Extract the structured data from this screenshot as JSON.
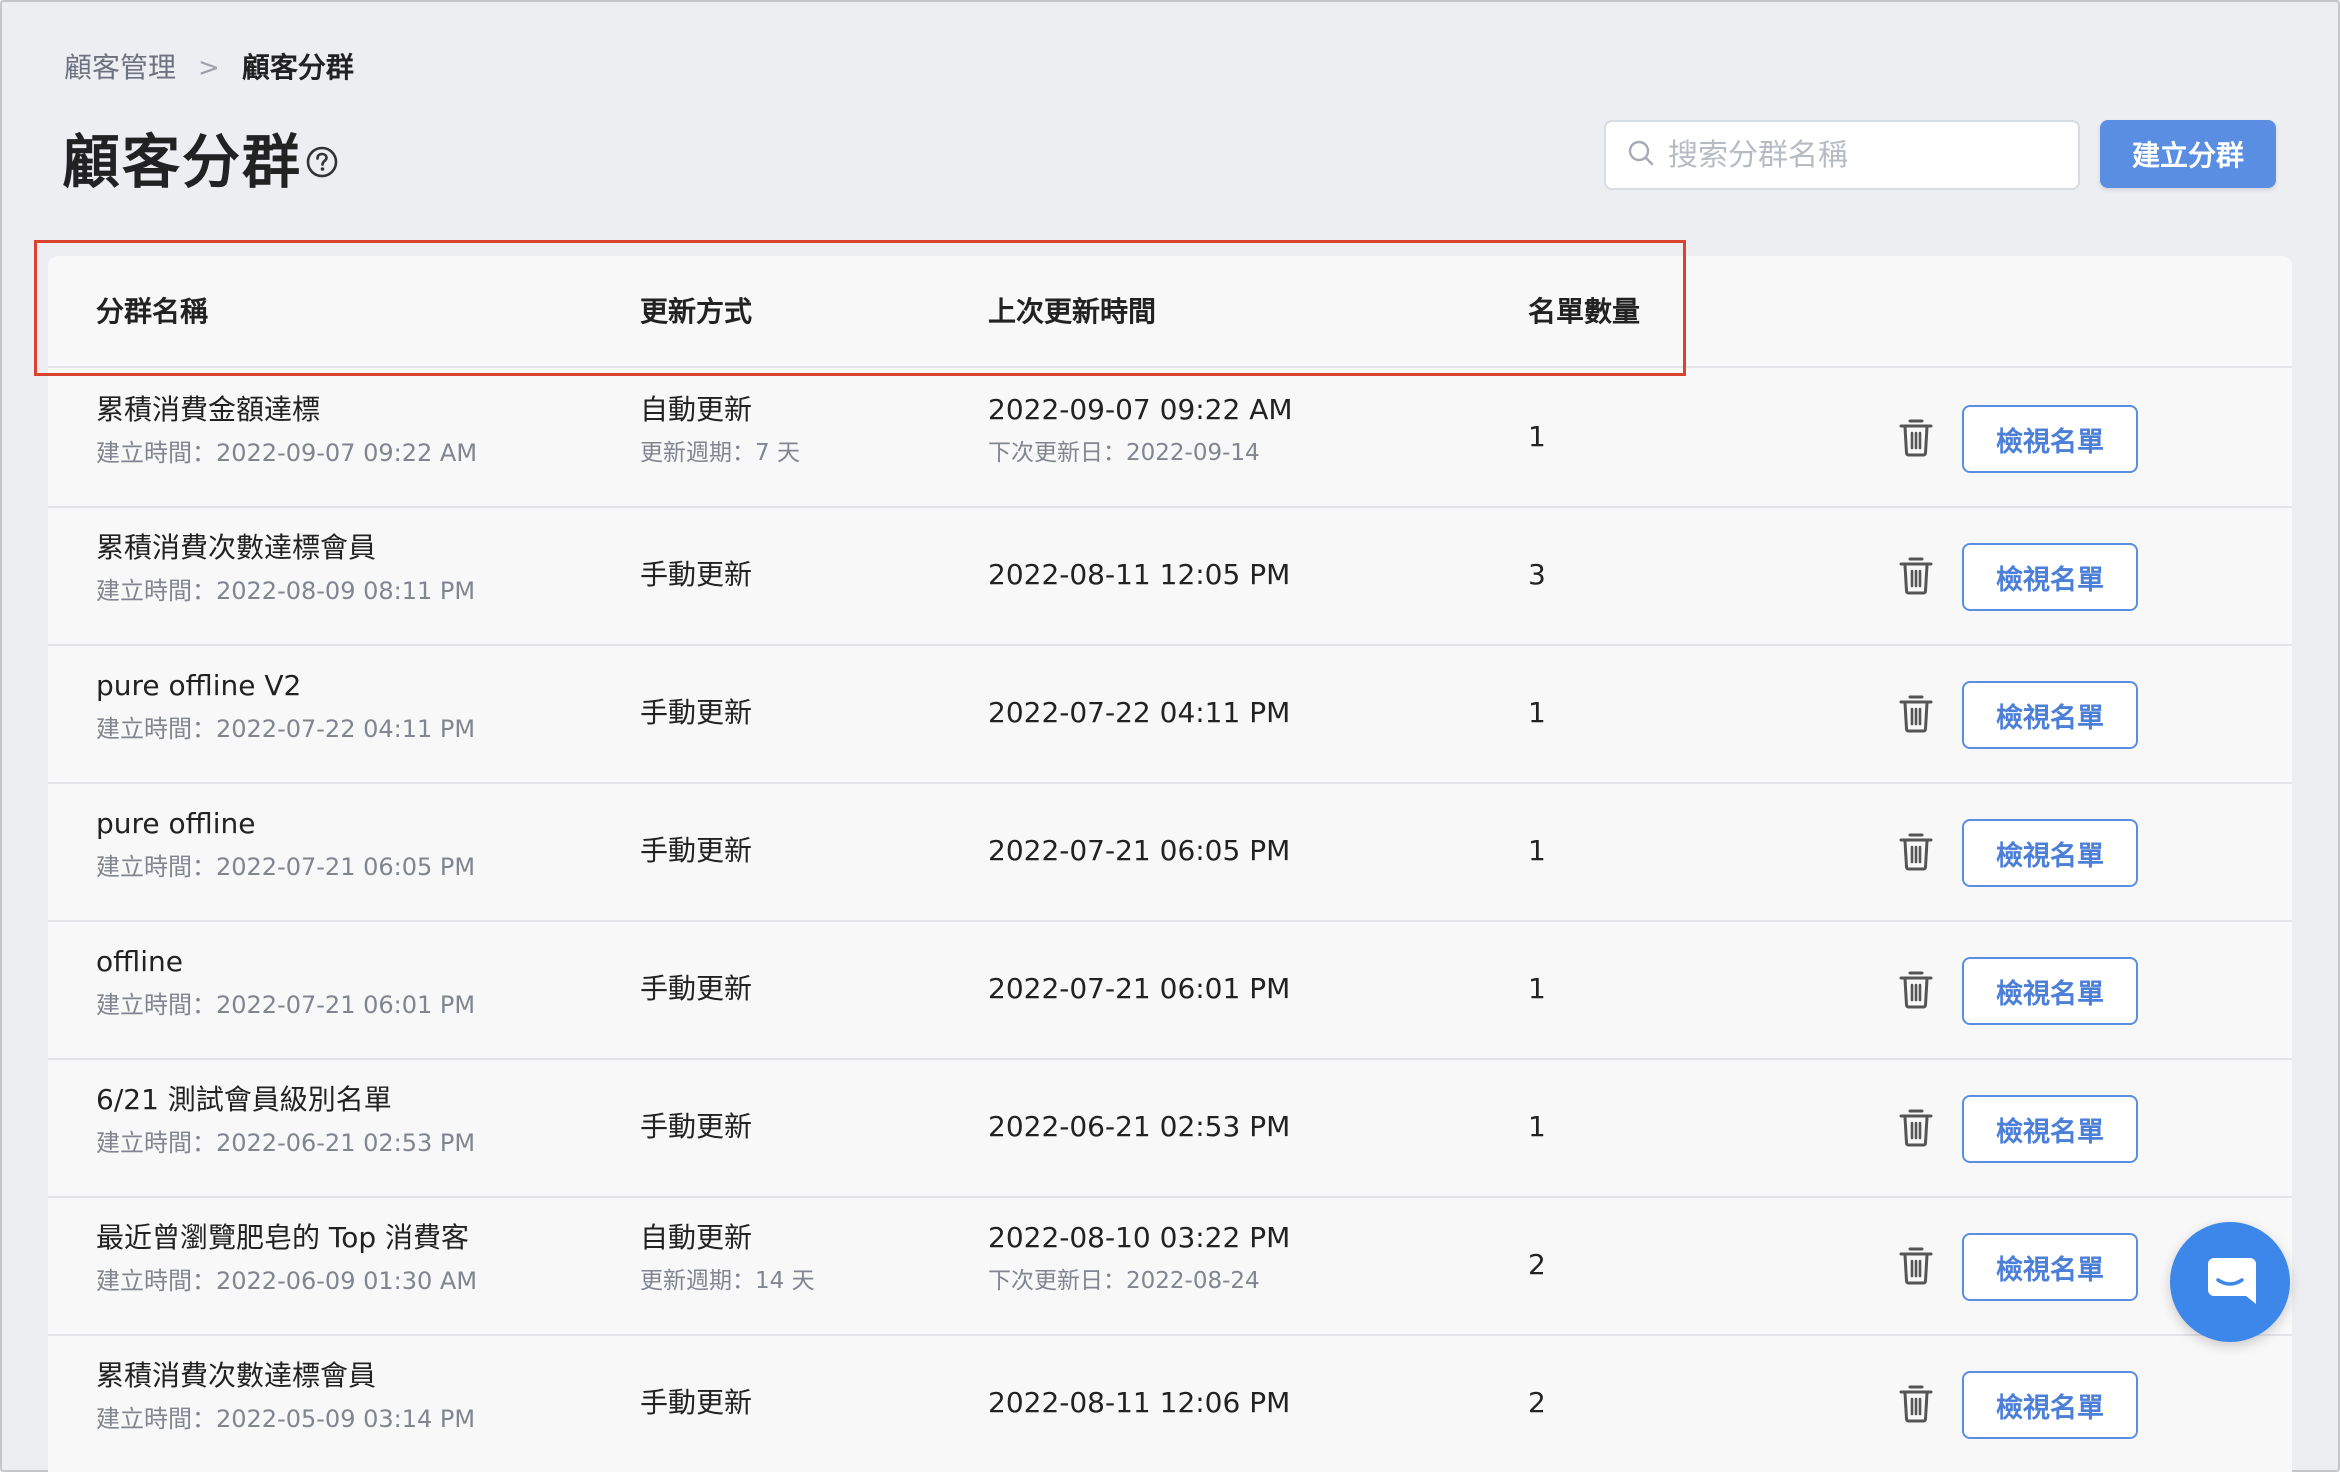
{
  "breadcrumb": {
    "parent": "顧客管理",
    "separator": ">",
    "current": "顧客分群"
  },
  "page": {
    "title": "顧客分群",
    "help_icon": "question-circle-icon"
  },
  "search": {
    "placeholder": "搜索分群名稱",
    "value": "",
    "icon": "search-icon"
  },
  "create_button": {
    "label": "建立分群",
    "color": "#5a8ee3"
  },
  "table": {
    "columns": [
      "分群名稱",
      "更新方式",
      "上次更新時間",
      "名單數量"
    ],
    "rows": [
      {
        "name": "累積消費金額達標",
        "created": "建立時間：2022-09-07 09:22 AM",
        "update_method": "自動更新",
        "update_cycle": "更新週期：7 天",
        "last_updated": "2022-09-07 09:22 AM",
        "next_update": "下次更新日：2022-09-14",
        "count": "1",
        "action": "檢視名單"
      },
      {
        "name": "累積消費次數達標會員",
        "created": "建立時間：2022-08-09 08:11 PM",
        "update_method": "手動更新",
        "update_cycle": "",
        "last_updated": "2022-08-11 12:05 PM",
        "next_update": "",
        "count": "3",
        "action": "檢視名單"
      },
      {
        "name": "pure offline V2",
        "created": "建立時間：2022-07-22 04:11 PM",
        "update_method": "手動更新",
        "update_cycle": "",
        "last_updated": "2022-07-22 04:11 PM",
        "next_update": "",
        "count": "1",
        "action": "檢視名單"
      },
      {
        "name": "pure offline",
        "created": "建立時間：2022-07-21 06:05 PM",
        "update_method": "手動更新",
        "update_cycle": "",
        "last_updated": "2022-07-21 06:05 PM",
        "next_update": "",
        "count": "1",
        "action": "檢視名單"
      },
      {
        "name": "offline",
        "created": "建立時間：2022-07-21 06:01 PM",
        "update_method": "手動更新",
        "update_cycle": "",
        "last_updated": "2022-07-21 06:01 PM",
        "next_update": "",
        "count": "1",
        "action": "檢視名單"
      },
      {
        "name": "6/21 測試會員級別名單",
        "created": "建立時間：2022-06-21 02:53 PM",
        "update_method": "手動更新",
        "update_cycle": "",
        "last_updated": "2022-06-21 02:53 PM",
        "next_update": "",
        "count": "1",
        "action": "檢視名單"
      },
      {
        "name": "最近曾瀏覽肥皂的 Top 消費客",
        "created": "建立時間：2022-06-09 01:30 AM",
        "update_method": "自動更新",
        "update_cycle": "更新週期：14 天",
        "last_updated": "2022-08-10 03:22 PM",
        "next_update": "下次更新日：2022-08-24",
        "count": "2",
        "action": "檢視名單"
      },
      {
        "name": "累積消費次數達標會員",
        "created": "建立時間：2022-05-09 03:14 PM",
        "update_method": "手動更新",
        "update_cycle": "",
        "last_updated": "2022-08-11 12:06 PM",
        "next_update": "",
        "count": "2",
        "action": "檢視名單"
      }
    ]
  },
  "icons": {
    "delete": "trash-icon",
    "chat": "chat-bubble-icon"
  },
  "colors": {
    "accent": "#5a8ee3",
    "highlight_box": "#d9432f",
    "chat_fab": "#3d86ea"
  }
}
